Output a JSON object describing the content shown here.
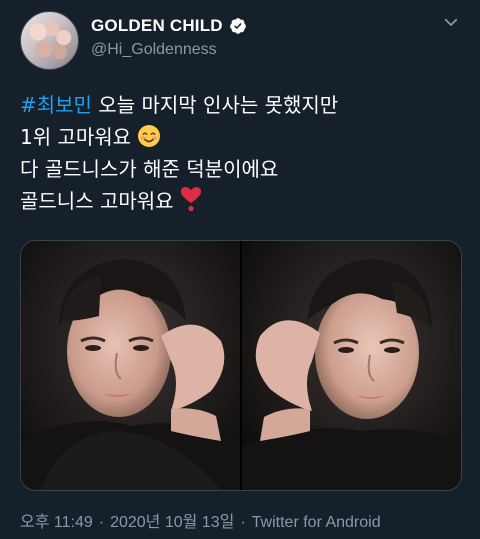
{
  "account": {
    "display_name": "GOLDEN CHILD",
    "handle": "@Hi_Goldenness",
    "verified": true
  },
  "tweet": {
    "hashtag": "#최보민",
    "line1_rest": " 오늘 마지막 인사는 못했지만",
    "line2": "1위 고마워요 ",
    "line3": "다 골드니스가 해준 덕분이에요",
    "line4": "골드니스 고마워요 ",
    "emojis": [
      "smiling-face-with-blush",
      "red-heart-exclamation"
    ]
  },
  "media": {
    "count": 2,
    "photos": [
      "selfie-heart-hand-left",
      "selfie-heart-hand-right"
    ]
  },
  "meta": {
    "time": "오후 11:49",
    "date": "2020년 10월 13일",
    "separator": "·",
    "source": "Twitter for Android"
  },
  "colors": {
    "background": "#15202b",
    "hashtag": "#1da1f2",
    "secondary_text": "#8899a6",
    "verified": "#ffffff"
  }
}
